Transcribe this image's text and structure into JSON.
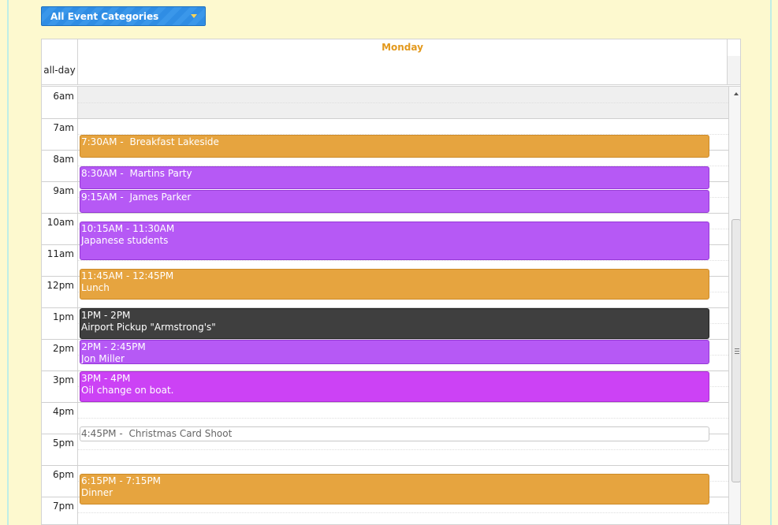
{
  "filter": {
    "label": "All Event Categories"
  },
  "calendar": {
    "day": "Monday",
    "allday_label": "all-day",
    "times": [
      "6am",
      "7am",
      "8am",
      "9am",
      "10am",
      "11am",
      "12pm",
      "1pm",
      "2pm",
      "3pm",
      "4pm",
      "5pm",
      "6pm",
      "7pm"
    ]
  },
  "events": [
    {
      "id": "breakfast",
      "time": "7:30AM - ",
      "title": "Breakfast Lakeside",
      "start": 7.5,
      "end": 8.25,
      "color": "#e6a43f",
      "border": "#cc8a28",
      "text": "#ffffff",
      "inline": true
    },
    {
      "id": "martins",
      "time": "8:30AM - ",
      "title": "Martins Party",
      "start": 8.5,
      "end": 9.25,
      "color": "#b659f5",
      "border": "#9538d6",
      "text": "#ffffff",
      "inline": true
    },
    {
      "id": "james",
      "time": "9:15AM - ",
      "title": "James Parker",
      "start": 9.25,
      "end": 10.0,
      "color": "#b659f5",
      "border": "#9538d6",
      "text": "#ffffff",
      "inline": true
    },
    {
      "id": "japanese",
      "time": "10:15AM - 11:30AM",
      "title": "Japanese students",
      "start": 10.25,
      "end": 11.5,
      "color": "#b659f5",
      "border": "#9538d6",
      "text": "#ffffff",
      "inline": false
    },
    {
      "id": "lunch",
      "time": "11:45AM - 12:45PM",
      "title": "Lunch",
      "start": 11.75,
      "end": 12.75,
      "color": "#e6a43f",
      "border": "#cc8a28",
      "text": "#ffffff",
      "inline": false
    },
    {
      "id": "airport",
      "time": "1PM - 2PM",
      "title": "Airport Pickup \"Armstrong's\"",
      "start": 13.0,
      "end": 14.0,
      "color": "#3f3f3f",
      "border": "#222222",
      "text": "#ffffff",
      "inline": false
    },
    {
      "id": "jon",
      "time": "2PM - 2:45PM",
      "title": "Jon Miller",
      "start": 14.0,
      "end": 14.8,
      "color": "#b659f5",
      "border": "#9538d6",
      "text": "#ffffff",
      "inline": false
    },
    {
      "id": "oil",
      "time": "3PM - 4PM",
      "title": "Oil change on boat.",
      "start": 15.0,
      "end": 16.0,
      "color": "#cc42f5",
      "border": "#a92ed1",
      "text": "#ffffff",
      "inline": false
    },
    {
      "id": "christmas",
      "time": "4:45PM - ",
      "title": "Christmas Card Shoot",
      "start": 16.75,
      "end": 17.25,
      "color": "#ffffff",
      "border": "#c8c8c8",
      "text": "#666666",
      "inline": true
    },
    {
      "id": "dinner",
      "time": "6:15PM - 7:15PM",
      "title": "Dinner",
      "start": 18.25,
      "end": 19.25,
      "color": "#e6a43f",
      "border": "#cc8a28",
      "text": "#ffffff",
      "inline": false
    }
  ]
}
